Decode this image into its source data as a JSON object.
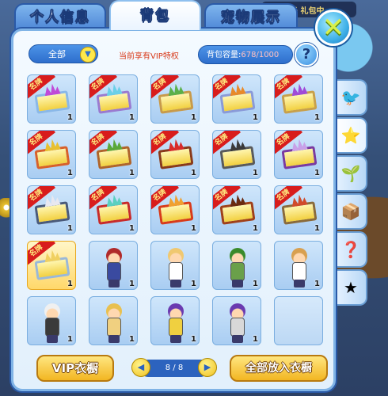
{
  "tabs": [
    {
      "label": "个人信息",
      "active": false
    },
    {
      "label": "背包",
      "active": true
    },
    {
      "label": "宠物展示",
      "active": false
    }
  ],
  "background_banner": "消息盒子 礼包中",
  "filter": {
    "selected": "全部",
    "icon": "chevron-down-icon"
  },
  "vip_note": "当前享有VIP特权",
  "capacity": {
    "label": "背包容量:",
    "value": "678/1000"
  },
  "help_label": "?",
  "close_label": "✕",
  "colors": {
    "panel_border": "#7fb3e6",
    "accent_blue": "#2e6ecc",
    "ribbon_red": "#d81c1c",
    "button_gold": "#f2b622"
  },
  "items": [
    {
      "kind": "frame",
      "badge": "名牌",
      "count": "1",
      "frame_color": "#8ab8e8",
      "deco": "#c04ad8"
    },
    {
      "kind": "frame",
      "badge": "名牌",
      "count": "1",
      "frame_color": "#9a7ad0",
      "deco": "#6ad0e8"
    },
    {
      "kind": "frame",
      "badge": "名牌",
      "count": "1",
      "frame_color": "#c89a4a",
      "deco": "#5ab04a"
    },
    {
      "kind": "frame",
      "badge": "名牌",
      "count": "1",
      "frame_color": "#8a9ad8",
      "deco": "#e88a2a"
    },
    {
      "kind": "frame",
      "badge": "名牌",
      "count": "1",
      "frame_color": "#c8a04a",
      "deco": "#a04ad8"
    },
    {
      "kind": "frame",
      "badge": "名牌",
      "count": "1",
      "frame_color": "#d8602a",
      "deco": "#e8c030"
    },
    {
      "kind": "frame",
      "badge": "名牌",
      "count": "1",
      "frame_color": "#b0642a",
      "deco": "#5aa83a"
    },
    {
      "kind": "frame",
      "badge": "名牌",
      "count": "1",
      "frame_color": "#8a3a1a",
      "deco": "#d82a2a"
    },
    {
      "kind": "frame",
      "badge": "名牌",
      "count": "1",
      "frame_color": "#5a5a5a",
      "deco": "#3a3a3a"
    },
    {
      "kind": "frame",
      "badge": "名牌",
      "count": "1",
      "frame_color": "#7a3aa0",
      "deco": "#c8a0e8"
    },
    {
      "kind": "frame",
      "badge": "名牌",
      "count": "1",
      "frame_color": "#4a5a7a",
      "deco": "#e8e8f0"
    },
    {
      "kind": "frame",
      "badge": "名牌",
      "count": "1",
      "frame_color": "#c82a2a",
      "deco": "#5ad0c0"
    },
    {
      "kind": "frame",
      "badge": "名牌",
      "count": "1",
      "frame_color": "#d83a1a",
      "deco": "#f0a030"
    },
    {
      "kind": "frame",
      "badge": "名牌",
      "count": "1",
      "frame_color": "#a0401a",
      "deco": "#6a2a10"
    },
    {
      "kind": "frame",
      "badge": "名牌",
      "count": "1",
      "frame_color": "#8a6a3a",
      "deco": "#d04a2a"
    },
    {
      "kind": "frame",
      "badge": "名牌",
      "count": "1",
      "frame_color": "#9ab8d8",
      "deco": "#f0d060",
      "selected": true
    },
    {
      "kind": "char",
      "badge": "",
      "count": "1",
      "hair": "#b02a2a",
      "outfit": "#3a4aa0"
    },
    {
      "kind": "char",
      "badge": "",
      "count": "1",
      "hair": "#f0c870",
      "outfit": "#ffffff"
    },
    {
      "kind": "char",
      "badge": "",
      "count": "1",
      "hair": "#3a8a2a",
      "outfit": "#6aa04a"
    },
    {
      "kind": "char",
      "badge": "",
      "count": "1",
      "hair": "#d8a050",
      "outfit": "#ffffff"
    },
    {
      "kind": "char",
      "badge": "",
      "count": "1",
      "hair": "#f0f0f0",
      "outfit": "#3a3a3a"
    },
    {
      "kind": "char",
      "badge": "",
      "count": "1",
      "hair": "#e8c050",
      "outfit": "#f0d080"
    },
    {
      "kind": "char",
      "badge": "",
      "count": "1",
      "hair": "#6a3ab0",
      "outfit": "#f0d040"
    },
    {
      "kind": "char",
      "badge": "",
      "count": "1",
      "hair": "#6a3ab0",
      "outfit": "#d8d8d8"
    },
    {
      "kind": "empty",
      "badge": "",
      "count": ""
    }
  ],
  "side_tabs": [
    {
      "icon": "bird-icon",
      "glyph": "🐦"
    },
    {
      "icon": "star-badge-icon",
      "glyph": "⭐"
    },
    {
      "icon": "seed-bag-icon",
      "glyph": "🌱"
    },
    {
      "icon": "box-icon",
      "glyph": "📦"
    },
    {
      "icon": "question-icon",
      "glyph": "❓"
    },
    {
      "icon": "star-icon",
      "glyph": "★"
    }
  ],
  "buttons": {
    "vip_box": "VIP衣橱",
    "put_all": "全部放入衣橱"
  },
  "pager": {
    "text": "8 / 8",
    "prev": "◀",
    "next": "▶"
  }
}
